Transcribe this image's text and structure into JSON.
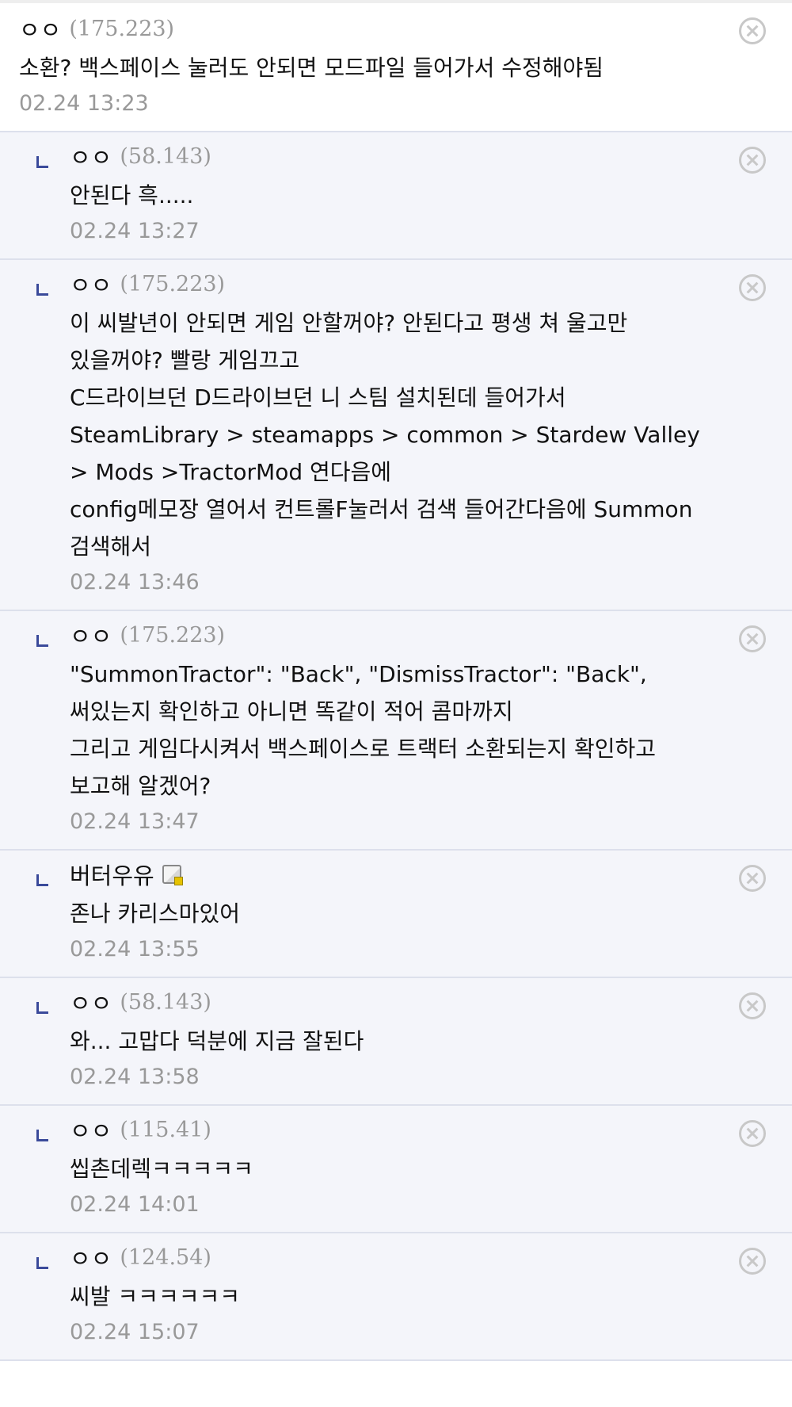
{
  "comments": [
    {
      "author": "ㅇㅇ",
      "ip": "(175.223)",
      "body": "소환? 백스페이스 눌러도 안되면 모드파일 들어가서 수정해야됨",
      "date": "02.24 13:23"
    },
    {
      "author": "ㅇㅇ",
      "ip": "(58.143)",
      "body": "안된다 흑.....",
      "date": "02.24 13:27"
    },
    {
      "author": "ㅇㅇ",
      "ip": "(175.223)",
      "body": "이 씨발년이 안되면 게임 안할꺼야? 안된다고 평생 쳐 울고만 있을꺼야? 빨랑 게임끄고\nC드라이브던 D드라이브던 니 스팀 설치된데 들어가서 SteamLibrary > steamapps > common > Stardew Valley > Mods >TractorMod 연다음에\nconfig메모장 열어서 컨트롤F눌러서 검색 들어간다음에 Summon 검색해서",
      "date": "02.24 13:46"
    },
    {
      "author": "ㅇㅇ",
      "ip": "(175.223)",
      "body": "\"SummonTractor\": \"Back\", \"DismissTractor\": \"Back\", 써있는지 확인하고 아니면 똑같이 적어 콤마까지\n그리고 게임다시켜서 백스페이스로 트랙터 소환되는지 확인하고 보고해 알겠어?",
      "date": "02.24 13:47"
    },
    {
      "author": "버터우유",
      "ip": "",
      "body": "존나 카리스마있어",
      "date": "02.24 13:55",
      "badge_icon": "fixed-nick-badge-icon"
    },
    {
      "author": "ㅇㅇ",
      "ip": "(58.143)",
      "body": "와... 고맙다 덕분에 지금 잘된다",
      "date": "02.24 13:58"
    },
    {
      "author": "ㅇㅇ",
      "ip": "(115.41)",
      "body": "씹촌데렉ㅋㅋㅋㅋㅋ",
      "date": "02.24 14:01"
    },
    {
      "author": "ㅇㅇ",
      "ip": "(124.54)",
      "body": "씨발 ㅋㅋㅋㅋㅋㅋ",
      "date": "02.24 15:07"
    }
  ]
}
